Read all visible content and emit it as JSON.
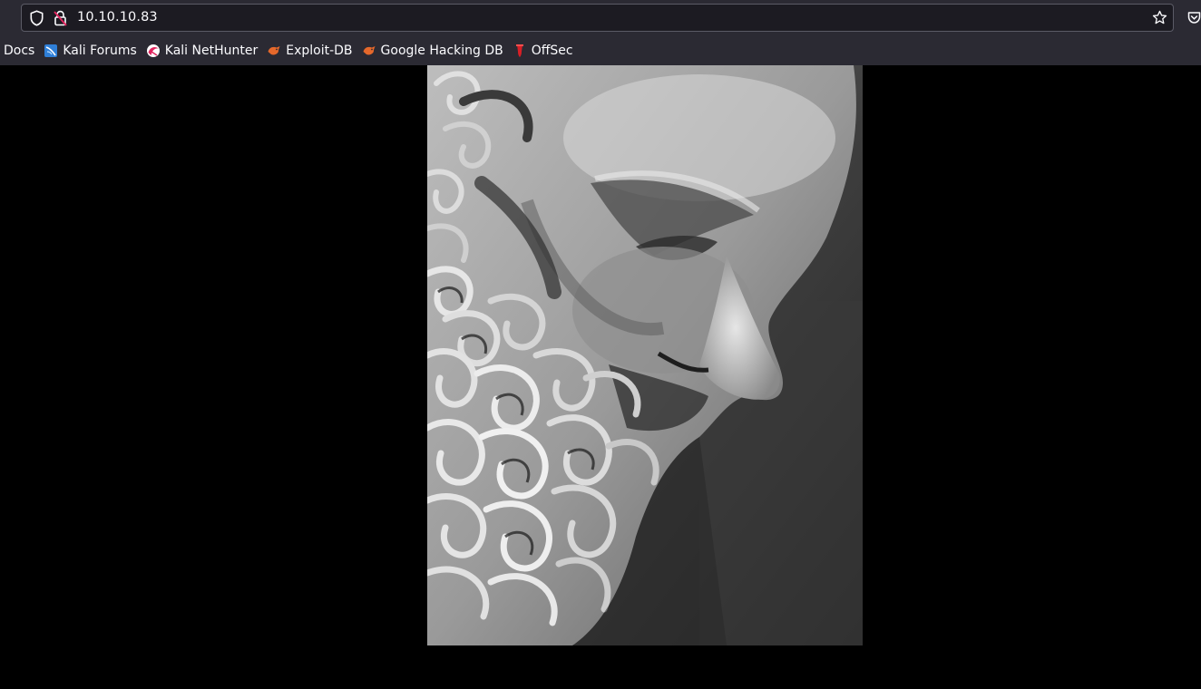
{
  "browser": {
    "url": "10.10.10.83",
    "icons": {
      "tracking_protection": "shield-icon",
      "connection": "not-secure-lock-icon",
      "bookmark_star": "star-icon",
      "pocket": "pocket-icon"
    },
    "bookmarks": [
      {
        "label": "Docs",
        "icon": "none"
      },
      {
        "label": "Kali Forums",
        "icon": "kali-forums-icon"
      },
      {
        "label": "Kali NetHunter",
        "icon": "kali-nethunter-icon"
      },
      {
        "label": "Exploit-DB",
        "icon": "exploit-db-icon"
      },
      {
        "label": "Google Hacking DB",
        "icon": "exploit-db-icon"
      },
      {
        "label": "OffSec",
        "icon": "offsec-icon"
      }
    ],
    "colors": {
      "toolbar": "#2b2a33",
      "urlbar": "#1c1b22",
      "text": "#fbfbfe",
      "accent_red": "#e0245e"
    }
  },
  "page": {
    "background": "#000000",
    "image": {
      "subject": "black-and-white close-up of a bearded marble statue head in profile"
    }
  }
}
